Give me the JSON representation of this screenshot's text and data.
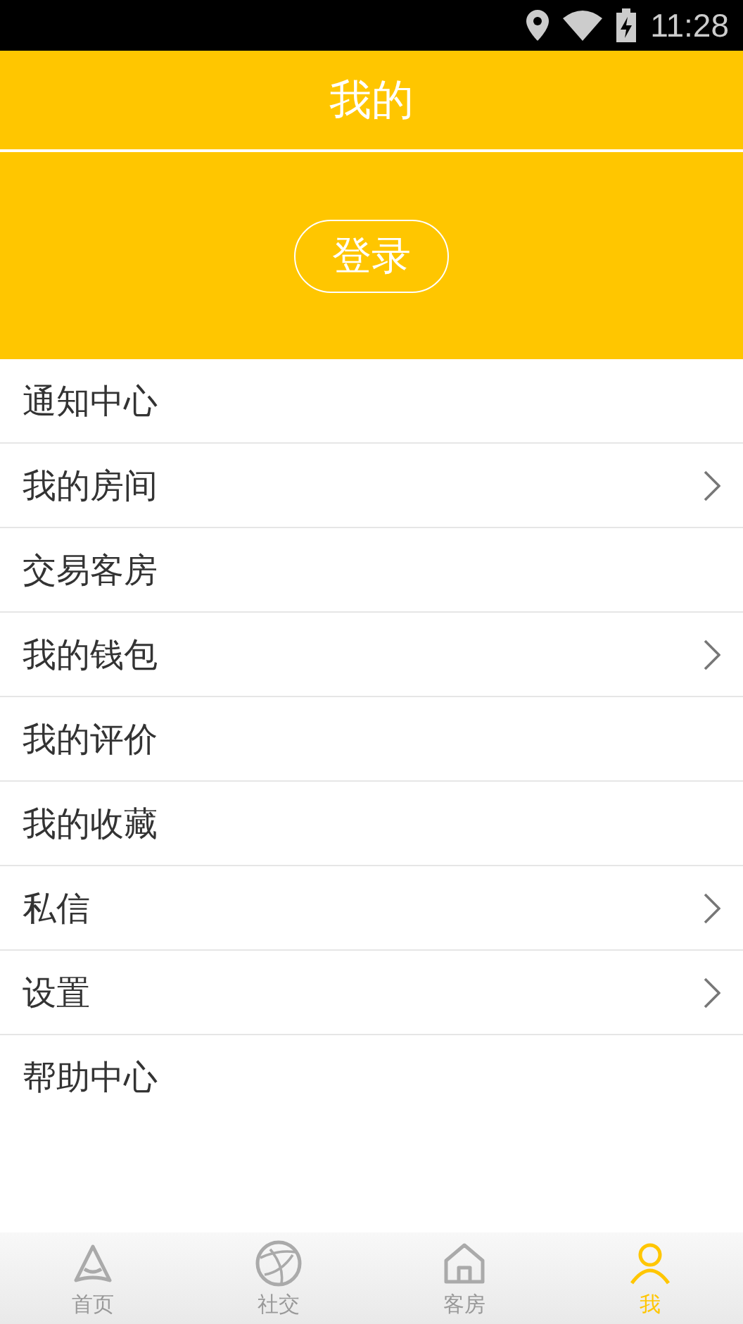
{
  "status_bar": {
    "time": "11:28"
  },
  "header": {
    "title": "我的"
  },
  "login_button": {
    "label": "登录"
  },
  "menu": [
    {
      "label": "通知中心",
      "has_arrow": false
    },
    {
      "label": "我的房间",
      "has_arrow": true
    },
    {
      "label": "交易客房",
      "has_arrow": false
    },
    {
      "label": "我的钱包",
      "has_arrow": true
    },
    {
      "label": "我的评价",
      "has_arrow": false
    },
    {
      "label": "我的收藏",
      "has_arrow": false
    },
    {
      "label": "私信",
      "has_arrow": true
    },
    {
      "label": "设置",
      "has_arrow": true
    },
    {
      "label": "帮助中心",
      "has_arrow": false
    }
  ],
  "tab_bar": [
    {
      "label": "首页",
      "kind": "home",
      "selected": false
    },
    {
      "label": "社交",
      "kind": "globe",
      "selected": false
    },
    {
      "label": "客房",
      "kind": "room",
      "selected": false
    },
    {
      "label": "我",
      "kind": "me",
      "selected": true
    }
  ]
}
